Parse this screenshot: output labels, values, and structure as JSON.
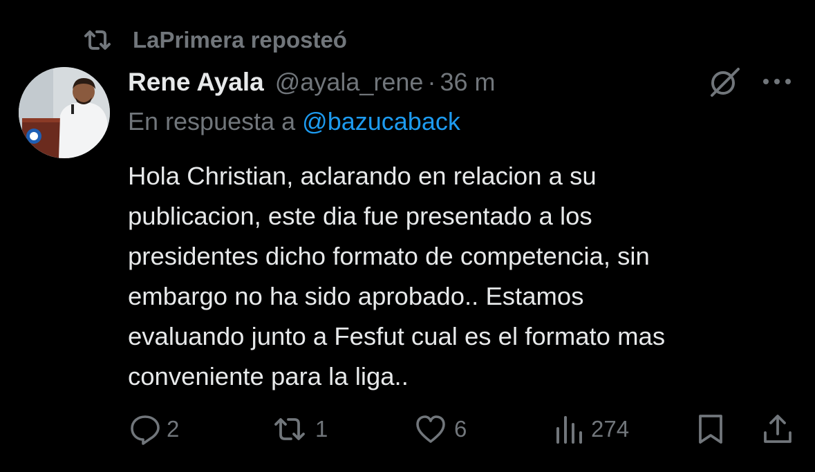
{
  "repost": {
    "text": "LaPrimera reposteó"
  },
  "author": {
    "name": "Rene Ayala",
    "handle": "@ayala_rene",
    "separator": "·",
    "time": "36 m"
  },
  "reply": {
    "prefix": "En respuesta a ",
    "mention": "@bazucaback"
  },
  "body_lines": [
    "Hola Christian, aclarando en relacion a su",
    "publicacion, este dia fue presentado a los",
    "presidentes dicho formato de competencia, sin",
    "embargo no ha sido aprobado..  Estamos",
    "evaluando junto a Fesfut cual es el formato mas",
    "conveniente para la liga.."
  ],
  "actions": {
    "replies": "2",
    "reposts": "1",
    "likes": "6",
    "views": "274"
  },
  "icons": {
    "repost_header": "repost-icon",
    "grok": "grok-icon",
    "more": "more-icon",
    "reply": "reply-icon",
    "repost": "repost-icon",
    "like": "heart-icon",
    "views": "views-icon",
    "bookmark": "bookmark-icon",
    "share": "share-icon"
  },
  "colors": {
    "background": "#000000",
    "text": "#e7e9ea",
    "muted": "#71767b",
    "link": "#1d9bf0"
  }
}
